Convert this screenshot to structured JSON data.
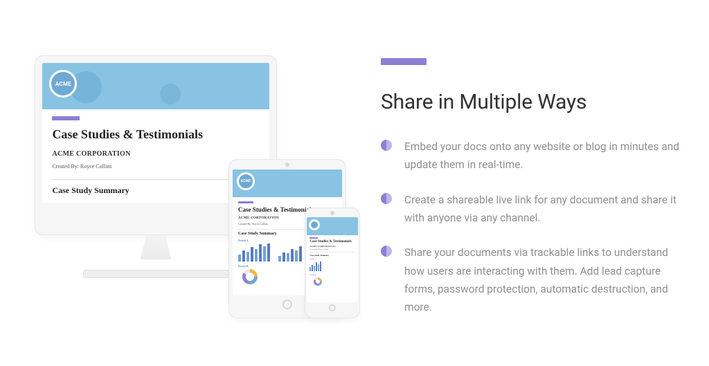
{
  "colors": {
    "accent": "#8b80d6",
    "header_strip": "#88c3e3",
    "text_muted": "#8f8f94"
  },
  "doc": {
    "logo_text": "ACME",
    "title": "Case Studies & Testimonials",
    "subtitle": "ACME CORPORATION",
    "meta": "Created By: Royce Collins",
    "section": "Case Study Summary",
    "result_a": "Result A",
    "result_b": "Result B"
  },
  "copy": {
    "heading": "Share in Multiple Ways",
    "bullets": [
      "Embed your docs onto any website or blog in minutes and update them in real-time.",
      "Create a shareable live link for any document and share it with anyone via any channel.",
      "Share your documents via trackable links to understand how users are interacting with them. Add lead capture forms, password protection, automatic destruction, and more."
    ]
  }
}
